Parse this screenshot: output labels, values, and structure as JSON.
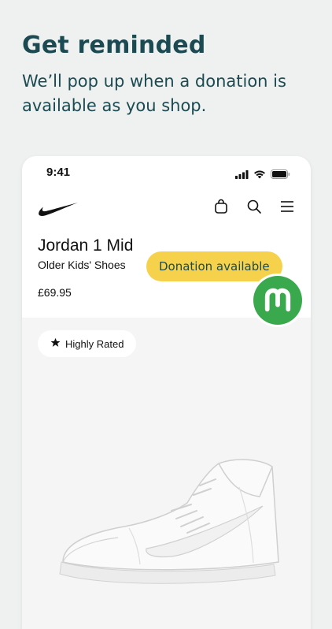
{
  "promo": {
    "headline": "Get reminded",
    "subtext": "We’ll pop up when a donation is available as you shop."
  },
  "phone": {
    "status_time": "9:41",
    "status_icons": [
      "signal-icon",
      "wifi-icon",
      "battery-icon"
    ],
    "nav_icons": [
      "bag-icon",
      "search-icon",
      "menu-icon"
    ],
    "brand_logo": "nike-swoosh-logo"
  },
  "product": {
    "title": "Jordan 1 Mid",
    "subtitle": "Older Kids' Shoes",
    "price": "£69.95",
    "rating_label": "Highly Rated"
  },
  "overlay": {
    "donation_label": "Donation available",
    "badge_letter": "M"
  },
  "colors": {
    "background": "#eef1ef",
    "headline": "#1c4a52",
    "donation_pill": "#f6d24c",
    "badge_green": "#3aa94e"
  }
}
